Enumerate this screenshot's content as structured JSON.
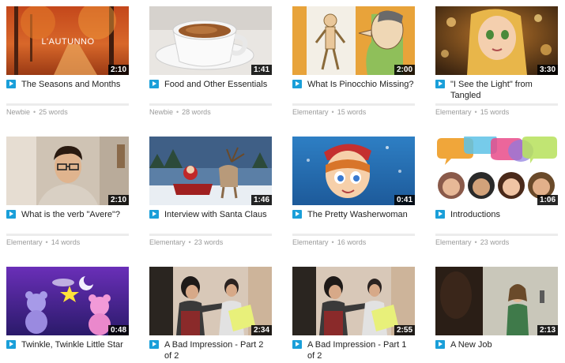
{
  "videos": [
    {
      "title": "The Seasons and Months",
      "duration": "2:10",
      "level": "Newbie",
      "words": "25 words",
      "thumb_icon": "autumn-forest-thumbnail",
      "thumb_text": "L'AUTUNNO"
    },
    {
      "title": "Food and Other Essentials",
      "duration": "1:41",
      "level": "Newbie",
      "words": "28 words",
      "thumb_icon": "espresso-cup-thumbnail"
    },
    {
      "title": "What Is Pinocchio Missing?",
      "duration": "2:00",
      "level": "Elementary",
      "words": "15 words",
      "thumb_icon": "pinocchio-cartoon-thumbnail"
    },
    {
      "title": "\"I See the Light\" from Tangled",
      "duration": "3:30",
      "level": "Elementary",
      "words": "15 words",
      "thumb_icon": "rapunzel-thumbnail"
    },
    {
      "title": "What is the verb \"Avere\"?",
      "duration": "2:10",
      "level": "Elementary",
      "words": "14 words",
      "thumb_icon": "man-with-glasses-thumbnail"
    },
    {
      "title": "Interview with Santa Claus",
      "duration": "1:46",
      "level": "Elementary",
      "words": "23 words",
      "thumb_icon": "santa-sleigh-thumbnail"
    },
    {
      "title": "The Pretty Washerwoman",
      "duration": "0:41",
      "level": "Elementary",
      "words": "16 words",
      "thumb_icon": "cartoon-girl-thumbnail"
    },
    {
      "title": "Introductions",
      "duration": "1:06",
      "level": "Elementary",
      "words": "23 words",
      "thumb_icon": "speech-bubbles-faces-thumbnail"
    },
    {
      "title": "Twinkle, Twinkle Little Star",
      "duration": "0:48",
      "level": "",
      "words": "",
      "thumb_icon": "teddy-bears-moon-thumbnail"
    },
    {
      "title": "A Bad Impression - Part 2 of 2",
      "duration": "2:34",
      "level": "",
      "words": "",
      "thumb_icon": "two-men-sign-thumbnail"
    },
    {
      "title": "A Bad Impression - Part 1 of 2",
      "duration": "2:55",
      "level": "",
      "words": "",
      "thumb_icon": "two-men-sign-thumbnail"
    },
    {
      "title": "A New Job",
      "duration": "2:13",
      "level": "",
      "words": "",
      "thumb_icon": "office-woman-thumbnail"
    }
  ],
  "colors": {
    "play_icon": "#1a9fd9",
    "meta_text": "#9a9a9a",
    "progress_track": "#ececec"
  }
}
